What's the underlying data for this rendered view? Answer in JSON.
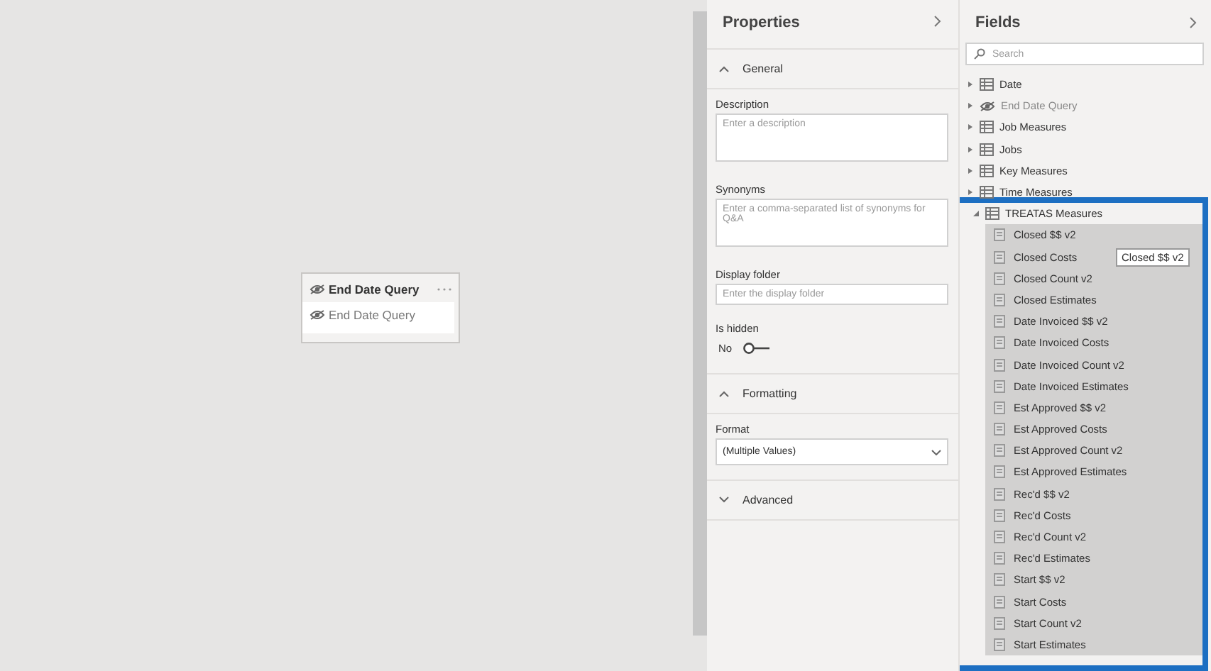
{
  "canvas": {
    "table_card": {
      "title": "End Date Query",
      "hidden": true,
      "fields": [
        {
          "name": "End Date Query",
          "hidden": true
        }
      ]
    }
  },
  "properties": {
    "title": "Properties",
    "sections": [
      {
        "kind": "general",
        "label": "General",
        "expanded": true,
        "description": {
          "label": "Description",
          "placeholder": "Enter a description"
        },
        "synonyms": {
          "label": "Synonyms",
          "placeholder": "Enter a comma-separated list of synonyms for Q&A"
        },
        "display_folder": {
          "label": "Display folder",
          "placeholder": "Enter the display folder"
        },
        "is_hidden": {
          "label": "Is hidden",
          "value": "No",
          "on": false
        }
      },
      {
        "kind": "formatting",
        "label": "Formatting",
        "expanded": true,
        "format": {
          "label": "Format",
          "value": "(Multiple Values)"
        }
      },
      {
        "kind": "advanced",
        "label": "Advanced",
        "expanded": false
      }
    ]
  },
  "fields": {
    "title": "Fields",
    "search": {
      "placeholder": "Search"
    },
    "tables": [
      {
        "name": "Date",
        "hidden": false,
        "expanded": false
      },
      {
        "name": "End Date Query",
        "hidden": true,
        "expanded": false
      },
      {
        "name": "Job Measures",
        "hidden": false,
        "expanded": false
      },
      {
        "name": "Jobs",
        "hidden": false,
        "expanded": false
      },
      {
        "name": "Key Measures",
        "hidden": false,
        "expanded": false
      },
      {
        "name": "Time Measures",
        "hidden": false,
        "expanded": false
      },
      {
        "name": "TREATAS Measures",
        "hidden": false,
        "expanded": true,
        "children": [
          {
            "name": "Closed $$ v2"
          },
          {
            "name": "Closed Costs"
          },
          {
            "name": "Closed Count v2"
          },
          {
            "name": "Closed Estimates"
          },
          {
            "name": "Date Invoiced $$ v2"
          },
          {
            "name": "Date Invoiced Costs"
          },
          {
            "name": "Date Invoiced Count v2"
          },
          {
            "name": "Date Invoiced Estimates"
          },
          {
            "name": "Est Approved $$ v2"
          },
          {
            "name": "Est Approved Costs"
          },
          {
            "name": "Est Approved Count v2"
          },
          {
            "name": "Est Approved Estimates"
          },
          {
            "name": "Rec'd $$ v2"
          },
          {
            "name": "Rec'd Costs"
          },
          {
            "name": "Rec'd Count v2"
          },
          {
            "name": "Rec'd Estimates"
          },
          {
            "name": "Start $$ v2"
          },
          {
            "name": "Start Costs"
          },
          {
            "name": "Start Count v2"
          },
          {
            "name": "Start Estimates"
          }
        ]
      }
    ],
    "tooltip": "Closed $$ v2"
  }
}
